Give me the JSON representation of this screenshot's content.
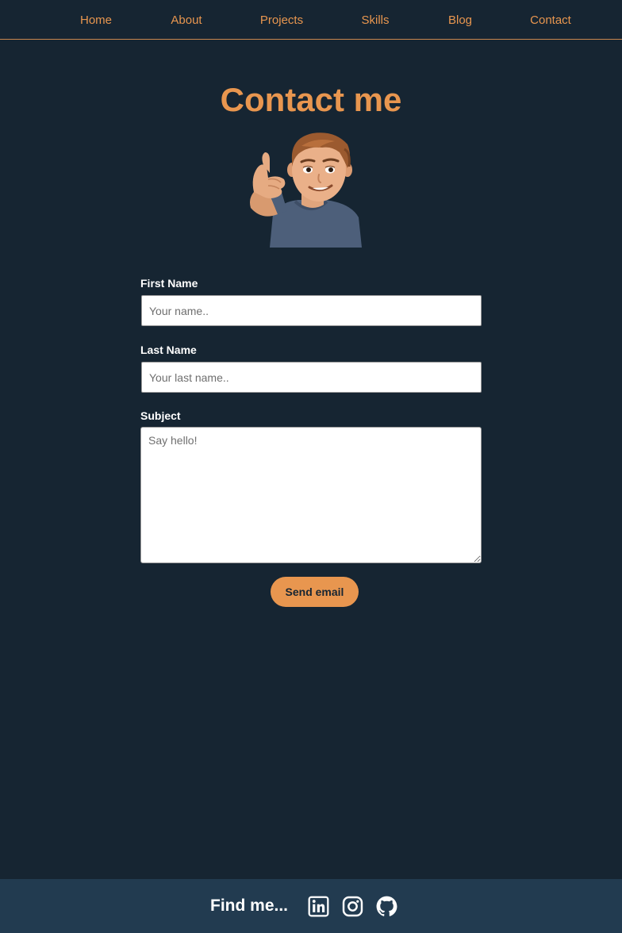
{
  "nav": {
    "items": [
      {
        "label": "Home"
      },
      {
        "label": "About"
      },
      {
        "label": "Projects"
      },
      {
        "label": "Skills"
      },
      {
        "label": "Blog"
      },
      {
        "label": "Contact"
      }
    ]
  },
  "page": {
    "title": "Contact me"
  },
  "form": {
    "first_name": {
      "label": "First Name",
      "placeholder": "Your name..",
      "value": ""
    },
    "last_name": {
      "label": "Last Name",
      "placeholder": "Your last name..",
      "value": ""
    },
    "subject": {
      "label": "Subject",
      "placeholder": "Say hello!",
      "value": ""
    },
    "submit_label": "Send email"
  },
  "footer": {
    "find_me": "Find me...",
    "social_icons": [
      "linkedin-icon",
      "instagram-icon",
      "github-icon"
    ]
  },
  "colors": {
    "background": "#162532",
    "accent": "#e8964f",
    "footer_background": "#223b50",
    "text_light": "#ffffff"
  }
}
